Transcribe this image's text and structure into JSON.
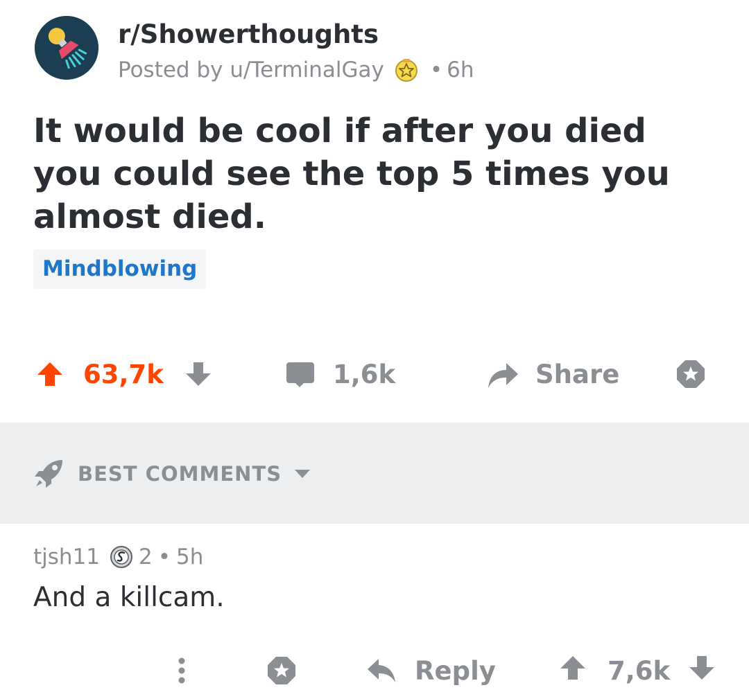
{
  "post": {
    "subreddit": "r/Showerthoughts",
    "posted_by": "Posted by u/TerminalGay",
    "separator": "•",
    "age": "6h",
    "title": "It would be cool if after you died you could see the top 5 times you almost died.",
    "flair": "Mindblowing",
    "upvotes": "63,7k",
    "comments": "1,6k",
    "share_label": "Share",
    "icons": {
      "avatar": "shower-lightbulb-icon",
      "user_flair": "star-badge-icon",
      "upvote": "arrow-up-icon",
      "downvote": "arrow-down-icon",
      "comments": "comment-bubble-icon",
      "share": "share-arrow-icon",
      "award": "award-star-icon"
    }
  },
  "comments_header": {
    "sort_label": "BEST COMMENTS",
    "icons": {
      "sort": "rocket-icon",
      "dropdown": "caret-down-icon"
    }
  },
  "comment": {
    "author": "tjsh11",
    "badge_count": "2",
    "separator": "•",
    "age": "5h",
    "body": "And a killcam.",
    "reply_label": "Reply",
    "score": "7,6k",
    "icons": {
      "badge": "silver-award-icon",
      "more": "more-vertical-icon",
      "award": "award-star-icon",
      "reply": "reply-arrow-icon",
      "upvote": "arrow-up-icon",
      "downvote": "arrow-down-icon"
    }
  },
  "colors": {
    "upvote_active": "#ff4500",
    "flair_text": "#1f77c9",
    "band_background": "#edeef0",
    "muted_text": "#8a8d91"
  }
}
